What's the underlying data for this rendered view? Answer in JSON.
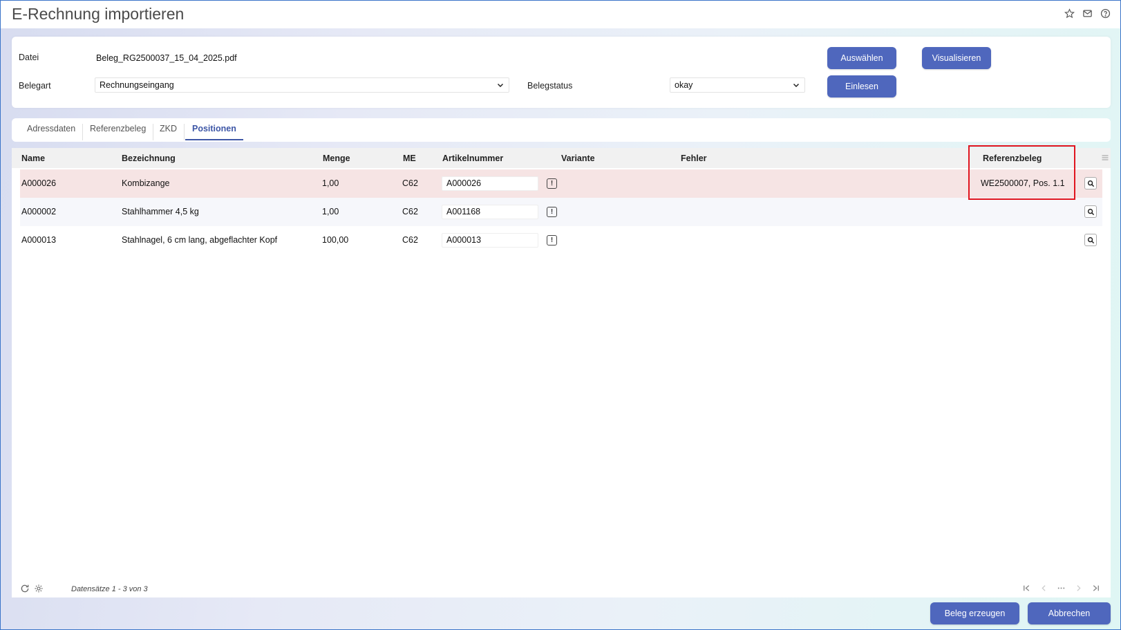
{
  "window": {
    "title": "E-Rechnung importieren"
  },
  "form": {
    "datei_label": "Datei",
    "datei_value": "Beleg_RG2500037_15_04_2025.pdf",
    "belegart_label": "Belegart",
    "belegart_value": "Rechnungseingang",
    "belegstatus_label": "Belegstatus",
    "belegstatus_value": "okay",
    "btn_auswaehlen": "Auswählen",
    "btn_visualisieren": "Visualisieren",
    "btn_einlesen": "Einlesen"
  },
  "tabs": [
    {
      "label": "Adressdaten"
    },
    {
      "label": "Referenzbeleg"
    },
    {
      "label": "ZKD"
    },
    {
      "label": "Positionen",
      "active": true
    }
  ],
  "table": {
    "headers": {
      "name": "Name",
      "bezeichnung": "Bezeichnung",
      "menge": "Menge",
      "me": "ME",
      "artikelnummer": "Artikelnummer",
      "variante": "Variante",
      "fehler": "Fehler",
      "referenzbeleg": "Referenzbeleg"
    },
    "rows": [
      {
        "name": "A000026",
        "bezeichnung": "Kombizange",
        "menge": "1,00",
        "me": "C62",
        "artikelnummer": "A000026",
        "referenzbeleg": "WE2500007, Pos. 1.1"
      },
      {
        "name": "A000002",
        "bezeichnung": "Stahlhammer 4,5 kg",
        "menge": "1,00",
        "me": "C62",
        "artikelnummer": "A001168",
        "referenzbeleg": ""
      },
      {
        "name": "A000013",
        "bezeichnung": "Stahlnagel, 6 cm lang, abgeflachter Kopf",
        "menge": "100,00",
        "me": "C62",
        "artikelnummer": "A000013",
        "referenzbeleg": ""
      }
    ],
    "records_text": "Datensätze 1 - 3 von 3"
  },
  "actions": {
    "beleg_erzeugen": "Beleg erzeugen",
    "abbrechen": "Abbrechen"
  },
  "colors": {
    "primary": "#4f67bd",
    "highlight": "#e0141e",
    "selected_row": "#f6e4e4"
  }
}
